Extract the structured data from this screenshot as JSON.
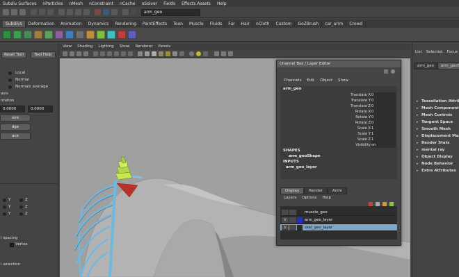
{
  "menubar": [
    "Subdiv Surfaces",
    "nParticles",
    "nMesh",
    "nConstraint",
    "nCache",
    "nSolver",
    "Fields",
    "Effects Assets",
    "Help"
  ],
  "status": {
    "object_name": "arm_geo"
  },
  "shelf_tabs": [
    "Subdivs",
    "Deformation",
    "Animation",
    "Dynamics",
    "Rendering",
    "PaintEffects",
    "Toon",
    "Muscle",
    "Fluids",
    "Fur",
    "Hair",
    "nCloth",
    "Custom",
    "GoZBrush",
    "car_arim",
    "Crowd"
  ],
  "shelf_active_tab": "Subdivs",
  "left_panel": {
    "reset_tool": "Reset Tool",
    "tool_help": "Tool Help",
    "local": "Local",
    "normal": "Normal",
    "normals_average": "Normals average",
    "axis_label": "axis",
    "orientation_label": "ntation",
    "field_a": "0.0000",
    "field_b": "0.0000",
    "btn_point": "oint",
    "btn_edge": "dge",
    "btn_face": "ace",
    "axis_y1": "Y",
    "axis_z1": "Z",
    "axis_y2": "Y",
    "axis_z2": "Z",
    "axis_y3": "Y",
    "axis_z3": "Z",
    "spacing_label": "l spacing",
    "vertex_label": "Vertex",
    "selection_label": "l selection"
  },
  "viewport": {
    "menu": [
      "View",
      "Shading",
      "Lighting",
      "Show",
      "Renderer",
      "Panels"
    ]
  },
  "channel_box": {
    "title": "Channel Box / Layer Editor",
    "menu": [
      "Channels",
      "Edit",
      "Object",
      "Show"
    ],
    "object": "arm_geo",
    "attributes": [
      {
        "label": "Translate X",
        "value": "0"
      },
      {
        "label": "Translate Y",
        "value": "0"
      },
      {
        "label": "Translate Z",
        "value": "0"
      },
      {
        "label": "Rotate X",
        "value": "0"
      },
      {
        "label": "Rotate Y",
        "value": "0"
      },
      {
        "label": "Rotate Z",
        "value": "0"
      },
      {
        "label": "Scale X",
        "value": "1"
      },
      {
        "label": "Scale Y",
        "value": "1"
      },
      {
        "label": "Scale Z",
        "value": "1"
      },
      {
        "label": "Visibility",
        "value": "on"
      }
    ],
    "shapes_header": "SHAPES",
    "shape_name": "arm_geoShape",
    "inputs_header": "INPUTS",
    "input_name": "arm_geo_layer",
    "tabs": [
      "Display",
      "Render",
      "Anim"
    ],
    "layer_menu": [
      "Layers",
      "Options",
      "Help"
    ],
    "layers": [
      {
        "vis": "",
        "name": "muscle_geo",
        "color": "#2a2a2a"
      },
      {
        "vis": "V",
        "name": "arm_geo_layer",
        "color": "#1f2fcf"
      },
      {
        "vis": "V",
        "name": "skel_geo_layer",
        "color": "#2a2a2a"
      }
    ]
  },
  "attribute_editor": {
    "menu": [
      "List",
      "Selected",
      "Focus"
    ],
    "tabs": [
      "arm_geo",
      "arm_geoSha"
    ],
    "sections": [
      "Tessellation Attrib",
      "Mesh Component",
      "Mesh Controls",
      "Tangent Space",
      "Smooth Mesh",
      "Displacement Map",
      "Render Stats",
      "mental ray",
      "Object Display",
      "Node Behavior",
      "Extra Attributes"
    ]
  },
  "colors": {
    "selected_layer": "#7fa7c7",
    "skeleton": "#6fb8e0",
    "vertebra": "#c9e64f",
    "skin": "#b3b3b3"
  }
}
